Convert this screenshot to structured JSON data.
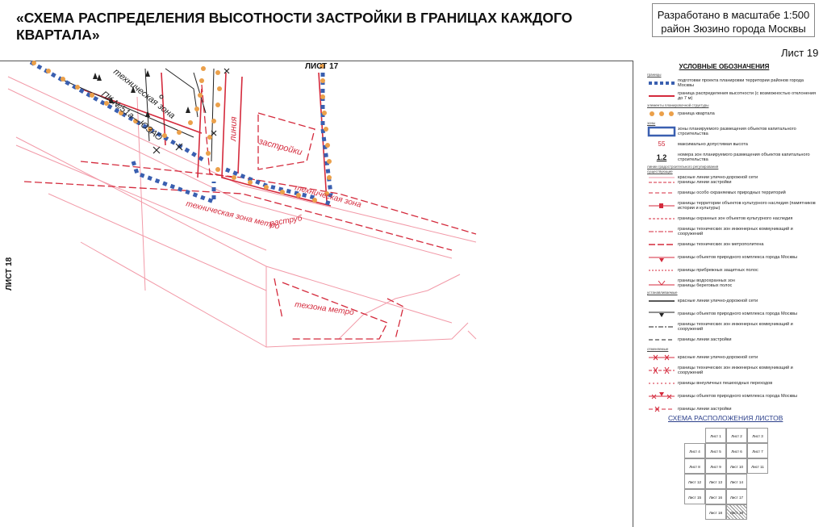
{
  "header": {
    "title": "«СХЕМА РАСПРЕДЕЛЕНИЯ ВЫСОТНОСТИ ЗАСТРОЙКИ В ГРАНИЦАХ КАЖДОГО КВАРТАЛА»",
    "scale_line1": "Разработано в масштабе 1:500",
    "scale_line2": "район Зюзино города Москвы",
    "sheet": "Лист 19"
  },
  "map": {
    "label_top": "ЛИСТ 17",
    "label_left": "ЛИСТ 18",
    "labels": {
      "tech_zone_1": "техническая зона",
      "pk": "ПК №51а—ЮЗАО",
      "liniya": "линия",
      "zastroiki": "застройки",
      "tech_zone_2": "техническая зона",
      "tech_zone_metro": "техническая зона метро",
      "rastrub": "раструб",
      "techzona_metro": "техзона метро"
    },
    "colors": {
      "red": "#d42a3c",
      "pink": "#f29aa8",
      "blue": "#3a5fb0",
      "orange": "#eba04a",
      "black": "#222"
    }
  },
  "legend": {
    "title": "УСЛОВНЫЕ ОБОЗНАЧЕНИЯ",
    "section_borders": "границы",
    "row1": "подготовки проекта планировки территории районов города Москвы",
    "row2": "граница распределения высотности (с возможностью отклонения до 7 м)",
    "section_elements": "элементы планировочной структуры",
    "row3": "граница квартала",
    "section_zones": "зоны",
    "row4": "зоны планируемого размещения объектов капитального строительства",
    "height_value": "55",
    "row5": "максимально допустимая высота",
    "zone_number": "1.2",
    "row6": "номера зон планируемого размещения объектов капитального строительства",
    "section_established": "линии градостроительного регулирования",
    "section_existing": "существующие",
    "row7": "красные линии улично-дорожной сети",
    "row8": "границы линии застройки",
    "row9": "границы особо охраняемых природных территорий",
    "row10": "границы территории объектов культурного наследия (памятников истории и культуры)",
    "row11": "границы охранных зон объектов культурного наследия",
    "row12": "границы технических зон инженерных коммуникаций и сооружений",
    "row13": "границы технических зон метрополитена",
    "row14": "границы объектов природного комплекса города Москвы",
    "row15": "границы прибрежных защитных полос",
    "row16": "границы водоохранных зон",
    "row17": "границы береговых полос",
    "section_set": "устанавливаемые",
    "row18": "красные линии улично-дорожной сети",
    "row19": "границы объектов природного комплекса города Москвы",
    "row20": "границы технических зон инженерных коммуникаций и сооружений",
    "row21": "границы линии застройки",
    "section_cancelled": "отменяемые",
    "row22": "красные линии улично-дорожной сети",
    "row23": "границы технических зон инженерных коммуникаций и сооружений",
    "row24": "границы внеуличных пешеходных переходов",
    "row25": "границы объектов природного комплекса города Москвы",
    "row26": "границы линии застройки"
  },
  "layout": {
    "title": "СХЕМА РАСПОЛОЖЕНИЯ ЛИСТОВ",
    "cells": [
      "Лист 1",
      "Лист 2",
      "Лист 3",
      "Лист 4",
      "Лист 5",
      "Лист 6",
      "Лист 7",
      "Лист 8",
      "Лист 9",
      "Лист 10",
      "Лист 11",
      "Лист 12",
      "Лист 13",
      "Лист 14",
      "Лист 15",
      "Лист 16",
      "Лист 17",
      "Лист 18",
      "Лист 19"
    ]
  }
}
